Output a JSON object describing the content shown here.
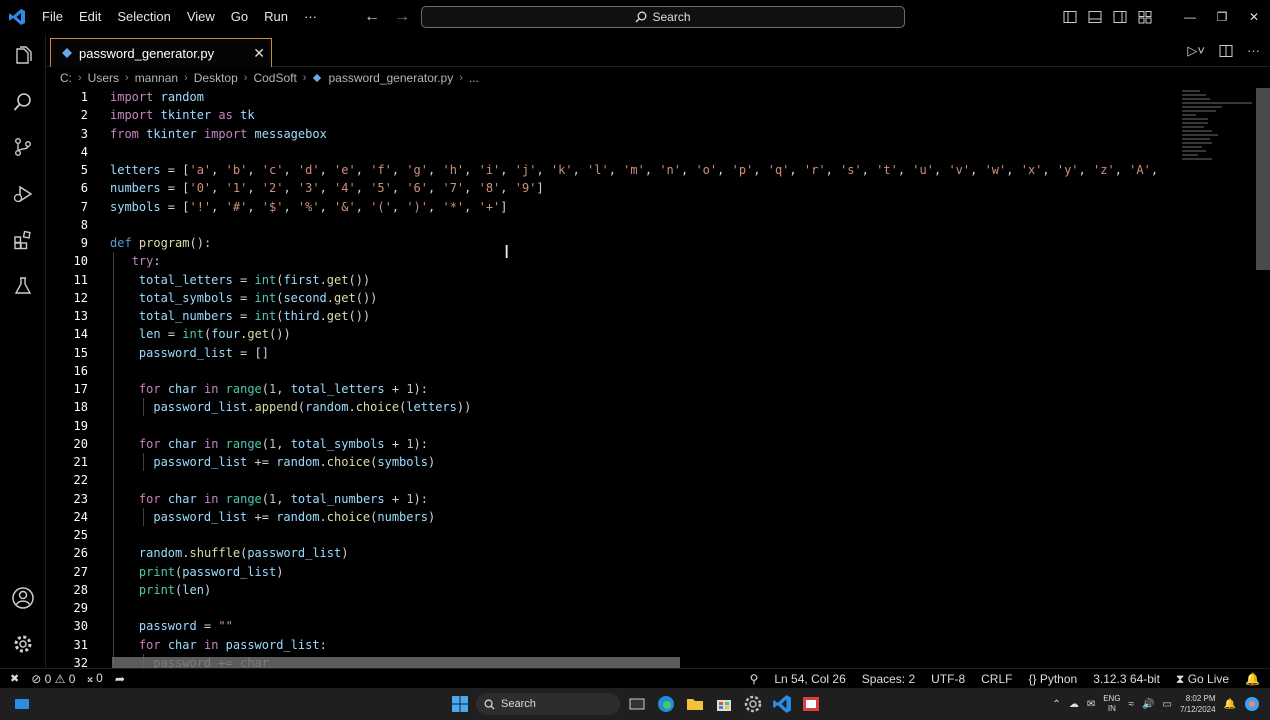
{
  "titlebar": {
    "menu": [
      "File",
      "Edit",
      "Selection",
      "View",
      "Go",
      "Run",
      "···"
    ],
    "search_label": "Search"
  },
  "tab": {
    "label": "password_generator.py"
  },
  "breadcrumb": [
    "C:",
    "Users",
    "mannan",
    "Desktop",
    "CodSoft",
    "password_generator.py",
    "..."
  ],
  "editor": {
    "line_numbers": [
      "1",
      "2",
      "3",
      "4",
      "5",
      "6",
      "7",
      "8",
      "9",
      "10",
      "11",
      "12",
      "13",
      "14",
      "15",
      "16",
      "17",
      "18",
      "19",
      "20",
      "21",
      "22",
      "23",
      "24",
      "25",
      "26",
      "27",
      "28",
      "29",
      "30",
      "31",
      "32"
    ],
    "lines": [
      "import random",
      "import tkinter as tk",
      "from tkinter import messagebox",
      "",
      "letters = ['a', 'b', 'c', 'd', 'e', 'f', 'g', 'h', 'i', 'j', 'k', 'l', 'm', 'n', 'o', 'p', 'q', 'r', 's', 't', 'u', 'v', 'w', 'x', 'y', 'z', 'A',",
      "numbers = ['0', '1', '2', '3', '4', '5', '6', '7', '8', '9']",
      "symbols = ['!', '#', '$', '%', '&', '(', ')', '*', '+']",
      "",
      "def program():",
      "   try:",
      "    total_letters = int(first.get())",
      "    total_symbols = int(second.get())",
      "    total_numbers = int(third.get())",
      "    len = int(four.get())",
      "    password_list = []",
      "",
      "    for char in range(1, total_letters + 1):",
      "      password_list.append(random.choice(letters))",
      "",
      "    for char in range(1, total_symbols + 1):",
      "      password_list += random.choice(symbols)",
      "",
      "    for char in range(1, total_numbers + 1):",
      "      password_list += random.choice(numbers)",
      "",
      "    random.shuffle(password_list)",
      "    print(password_list)",
      "    print(len)",
      "",
      "    password = \"\"",
      "    for char in password_list:",
      "      password += char"
    ]
  },
  "statusbar": {
    "errors": "0",
    "warnings": "0",
    "info": "0",
    "position": "Ln 54, Col 26",
    "spaces": "Spaces: 2",
    "encoding": "UTF-8",
    "eol": "CRLF",
    "language": "Python",
    "interpreter": "3.12.3 64-bit",
    "golive": "Go Live"
  },
  "taskbar": {
    "search_label": "Search",
    "lang_top": "ENG",
    "lang_bottom": "IN",
    "time": "8:02 PM",
    "date": "7/12/2024"
  },
  "colors": {
    "accent_tab_border": "#c7892e",
    "background": "#000000",
    "vscode_blue": "#2b8ce6"
  }
}
